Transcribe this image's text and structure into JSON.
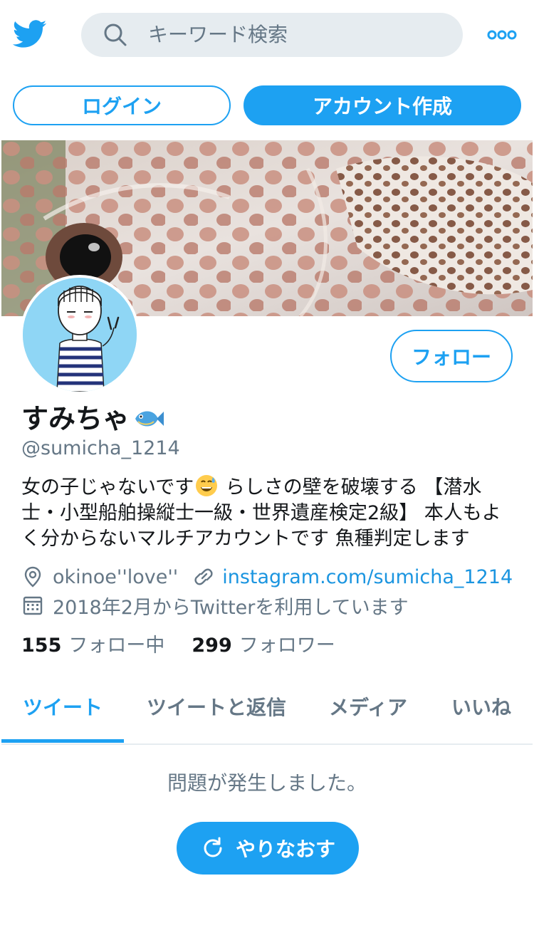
{
  "colors": {
    "accent": "#1da1f2",
    "text": "#14171a",
    "secondary": "#657786",
    "search_bg": "#e6ecf0"
  },
  "header": {
    "logo_icon": "twitter-bird-icon",
    "search": {
      "icon": "search-icon",
      "placeholder": "キーワード検索"
    },
    "more_icon": "more-dots-icon"
  },
  "auth": {
    "login_label": "ログイン",
    "signup_label": "アカウント作成"
  },
  "profile": {
    "banner": "fish-photo",
    "follow_label": "フォロー",
    "name": "すみちゃ",
    "name_emoji": "fish-emoji",
    "handle": "@sumicha_1214",
    "bio_part1": "女の子じゃないです",
    "bio_emoji": "grinning-sweat-emoji",
    "bio_part2": " らしさの壁を破壊する 【潜水士・小型船舶操縦士一級・世界遺産検定2級】 本人もよく分からないマルチアカウントです 魚種判定します",
    "location": "okinoe''love''",
    "website": "instagram.com/sumicha_1214",
    "joined": "2018年2月からTwitterを利用しています",
    "following_count": "155",
    "following_label": "フォロー中",
    "followers_count": "299",
    "followers_label": "フォロワー"
  },
  "tabs": [
    {
      "label": "ツイート",
      "active": true
    },
    {
      "label": "ツイートと返信",
      "active": false
    },
    {
      "label": "メディア",
      "active": false
    },
    {
      "label": "いいね",
      "active": false
    }
  ],
  "timeline": {
    "error_message": "問題が発生しました。",
    "retry_label": "やりなおす"
  }
}
